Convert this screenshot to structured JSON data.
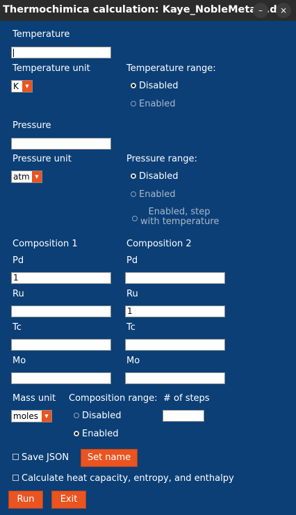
{
  "window": {
    "title": "Thermochimica calculation: Kaye_NobleMetals.dat",
    "minimize_label": "–",
    "close_label": "×"
  },
  "temperature": {
    "label": "Temperature",
    "value": "",
    "unit_label": "Temperature unit",
    "unit_value": "K",
    "range_label": "Temperature range:",
    "range_options": [
      "Disabled",
      "Enabled"
    ],
    "range_selected": "Disabled"
  },
  "pressure": {
    "label": "Pressure",
    "value": "",
    "unit_label": "Pressure unit",
    "unit_value": "atm",
    "range_label": "Pressure range:",
    "range_options": [
      "Disabled",
      "Enabled",
      "Enabled, step",
      "with temperature"
    ],
    "range_selected": "Disabled"
  },
  "composition": {
    "col1_label": "Composition 1",
    "col2_label": "Composition 2",
    "elements": [
      {
        "name": "Pd",
        "value1": "1",
        "value2": ""
      },
      {
        "name": "Ru",
        "value1": "",
        "value2": "1"
      },
      {
        "name": "Tc",
        "value1": "",
        "value2": ""
      },
      {
        "name": "Mo",
        "value1": "",
        "value2": ""
      }
    ]
  },
  "mass": {
    "unit_label": "Mass unit",
    "unit_value": "moles",
    "range_label": "Composition range:",
    "range_options": [
      "Disabled",
      "Enabled"
    ],
    "range_selected": "Enabled",
    "steps_label": "# of steps",
    "steps_value": ""
  },
  "options": {
    "save_json_label": "Save JSON",
    "save_json_checked": false,
    "set_name_label": "Set name",
    "heat_capacity_label": "Calculate heat capacity, entropy, and enthalpy",
    "heat_capacity_checked": false
  },
  "actions": {
    "run_label": "Run",
    "exit_label": "Exit"
  },
  "colors": {
    "background": "#0b3f76",
    "accent": "#e95420",
    "titlebar": "#2c2c2c"
  }
}
